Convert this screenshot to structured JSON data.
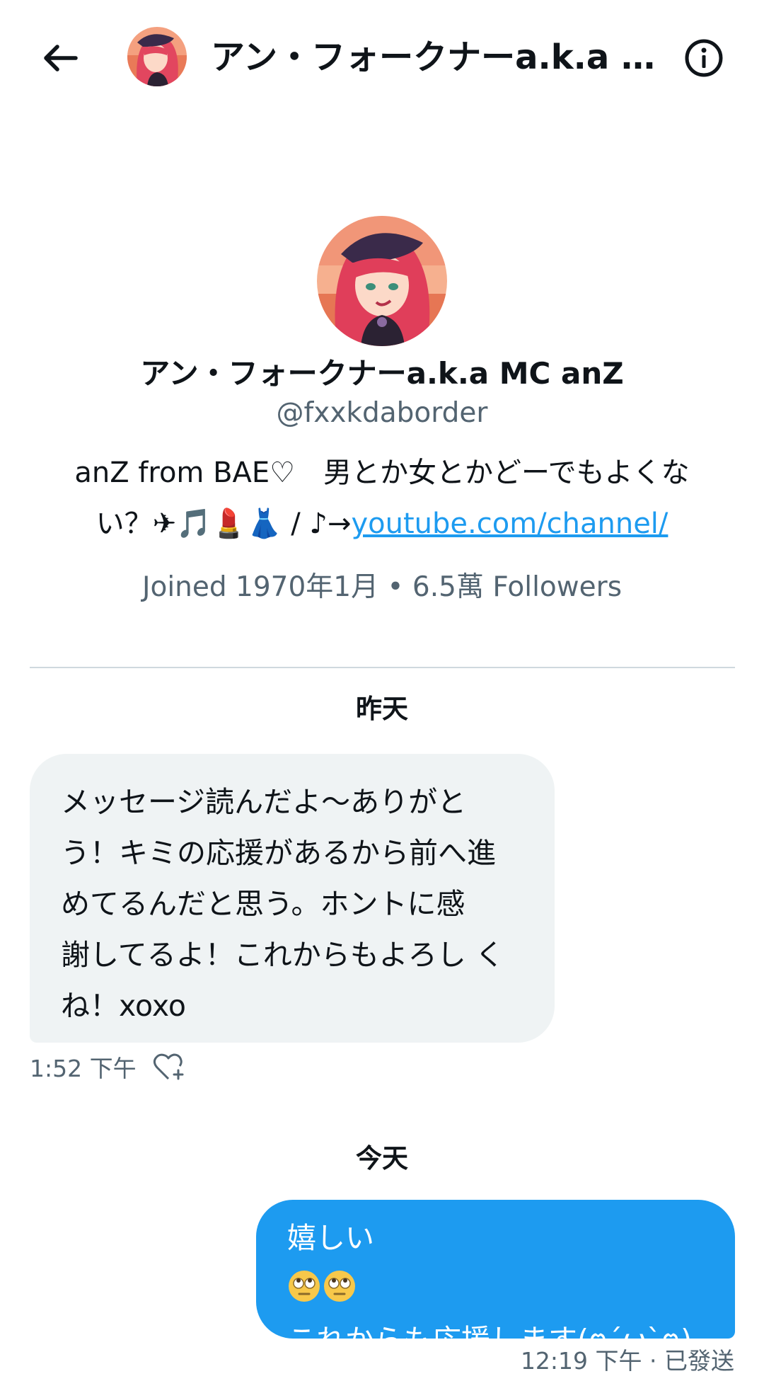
{
  "header": {
    "back_icon": "arrow-left-icon",
    "title": "アン・フォークナーa.k.a MC anZ",
    "info_icon": "info-circle-icon"
  },
  "profile": {
    "name": "アン・フォークナーa.k.a MC anZ",
    "handle": "@fxxkdaborder",
    "bio_line1": "anZ from BAE♡　男とか女とかどーでもよくな",
    "bio_line2_prefix": "い？✈🎵💄👗 / ♪→",
    "bio_link": "youtube.com/channel/",
    "joined": "Joined 1970年1月",
    "separator": "•",
    "followers": "6.5萬 Followers"
  },
  "conversation": {
    "yesterday_label": "昨天",
    "today_label": "今天",
    "messages": [
      {
        "direction": "incoming",
        "lines": [
          "メッセージ読んだよ〜ありがと",
          "う！キミの応援があるから前へ進",
          "めてるんだと思う。ホントに感",
          "謝してるよ！これからもよろし く",
          "ね！xoxo"
        ],
        "time": "1:52 下午",
        "reaction_icon": "heart-add-icon"
      },
      {
        "direction": "outgoing",
        "line1_text": "嬉しい",
        "line1_emoji": "face-with-rolling-eyes",
        "line2": "これからも応援します(ฅ´ω`ฅ)",
        "time_status": "12:19 下午 · 已發送"
      }
    ]
  },
  "colors": {
    "accent": "#1d9bf0",
    "incoming_bubble": "#eff3f4",
    "secondary_text": "#536471",
    "divider": "#cfd9de"
  }
}
